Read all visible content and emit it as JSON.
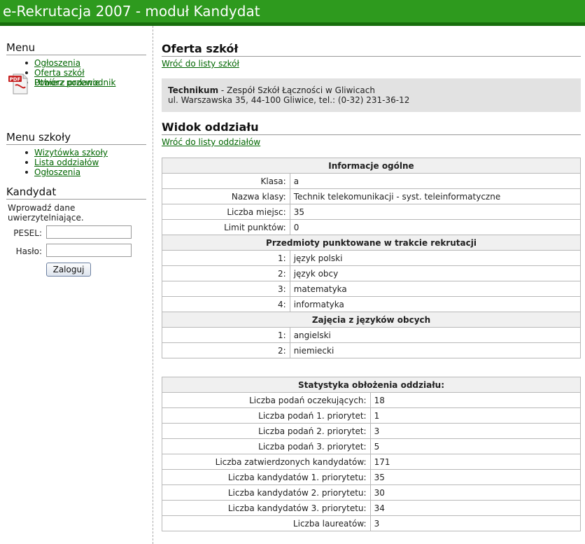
{
  "header": {
    "title": "e-Rekrutacja 2007 - moduł Kandydat"
  },
  "sidebar": {
    "menu_title": "Menu",
    "menu_items": [
      "Ogłoszenia",
      "Oferta szkół",
      "Utwórz podanie"
    ],
    "pdf_icon_text": "PDF",
    "pdf_link": "Pobierz przewodnik",
    "school_menu_title": "Menu szkoły",
    "school_menu_items": [
      "Wizytówka szkoły",
      "Lista oddziałów",
      "Ogłoszenia"
    ],
    "candidate_title": "Kandydat",
    "login_text": "Wprowadź dane uwierzytelniające.",
    "pesel_label": "PESEL:",
    "password_label": "Hasło:",
    "login_button": "Zaloguj"
  },
  "main": {
    "offer_title": "Oferta szkół",
    "back_to_schools": "Wróć do listy szkół",
    "school_type": "Technikum",
    "school_name": " - Zespół Szkół Łączności w Gliwicach",
    "school_address": "ul. Warszawska 35, 44-100 Gliwice, tel.: (0-32) 231-36-12",
    "view_title": "Widok oddziału",
    "back_to_classes": "Wróć do listy oddziałów",
    "general_info": {
      "header": "Informacje ogólne",
      "rows": [
        {
          "key": "Klasa:",
          "value": "a"
        },
        {
          "key": "Nazwa klasy:",
          "value": "Technik telekomunikacji - syst. teleinformatyczne"
        },
        {
          "key": "Liczba miejsc:",
          "value": "35"
        },
        {
          "key": "Limit punktów:",
          "value": "0"
        }
      ]
    },
    "subjects": {
      "header": "Przedmioty punktowane w trakcie rekrutacji",
      "rows": [
        {
          "key": "1:",
          "value": "język polski"
        },
        {
          "key": "2:",
          "value": "język obcy"
        },
        {
          "key": "3:",
          "value": "matematyka"
        },
        {
          "key": "4:",
          "value": "informatyka"
        }
      ]
    },
    "languages": {
      "header": "Zajęcia z języków obcych",
      "rows": [
        {
          "key": "1:",
          "value": "angielski"
        },
        {
          "key": "2:",
          "value": "niemiecki"
        }
      ]
    },
    "stats": {
      "header": "Statystyka obłożenia oddziału:",
      "rows": [
        {
          "key": "Liczba podań oczekujących:",
          "value": "18"
        },
        {
          "key": "Liczba podań 1. priorytet:",
          "value": "1"
        },
        {
          "key": "Liczba podań 2. priorytet:",
          "value": "3"
        },
        {
          "key": "Liczba podań 3. priorytet:",
          "value": "5"
        },
        {
          "key": "Liczba zatwierdzonych kandydatów:",
          "value": "171"
        },
        {
          "key": "Liczba kandydatów 1. priorytetu:",
          "value": "35"
        },
        {
          "key": "Liczba kandydatów 2. priorytetu:",
          "value": "30"
        },
        {
          "key": "Liczba kandydatów 3. priorytetu:",
          "value": "34"
        },
        {
          "key": "Liczba laureatów:",
          "value": "3"
        }
      ]
    }
  }
}
